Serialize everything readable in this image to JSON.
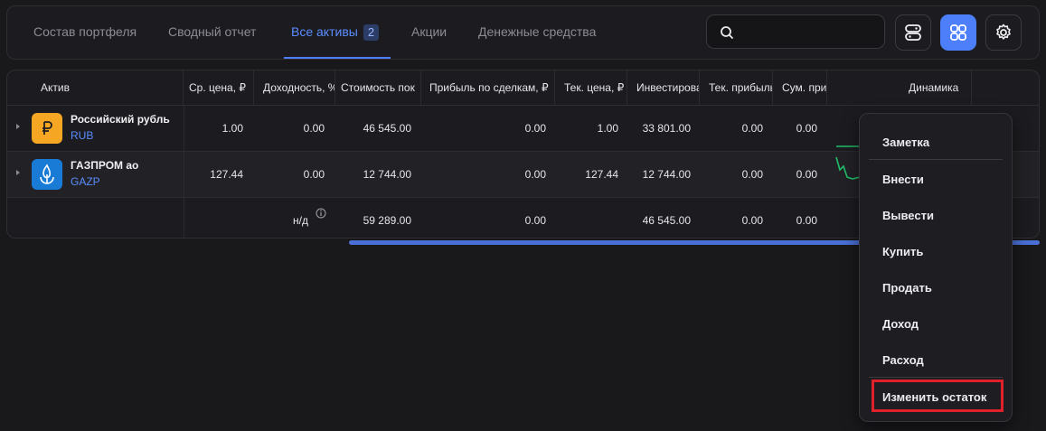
{
  "tabs": [
    {
      "label": "Состав портфеля"
    },
    {
      "label": "Сводный отчет"
    },
    {
      "label": "Все активы",
      "badge": "2"
    },
    {
      "label": "Акции"
    },
    {
      "label": "Денежные средства"
    }
  ],
  "search": {
    "placeholder": ""
  },
  "table": {
    "headers": [
      "Актив",
      "Ср. цена, ₽",
      "Доходность, %",
      "Стоимость пок",
      "Прибыль по сделкам, ₽",
      "Тек. цена, ₽",
      "Инвестирова",
      "Тек. прибыль",
      "Сум. при",
      "Динамика"
    ],
    "rows": [
      {
        "name": "Российский рубль",
        "ticker": "RUB",
        "icon": "ruble-icon",
        "avg_price": "1.00",
        "yield": "0.00",
        "cost": "46 545.00",
        "deal_profit": "0.00",
        "cur_price": "1.00",
        "invested": "33 801.00",
        "cur_profit": "0.00",
        "sum_profit": "0.00"
      },
      {
        "name": "ГАЗПРОМ ао",
        "ticker": "GAZP",
        "icon": "gazprom-logo-icon",
        "avg_price": "127.44",
        "yield": "0.00",
        "cost": "12 744.00",
        "deal_profit": "0.00",
        "cur_price": "127.44",
        "invested": "12 744.00",
        "cur_profit": "0.00",
        "sum_profit": "0.00"
      }
    ],
    "total": {
      "yield": "н/д",
      "cost": "59 289.00",
      "deal_profit": "0.00",
      "invested": "46 545.00",
      "cur_profit": "0.00",
      "sum_profit": "0.00"
    }
  },
  "menu": {
    "items": [
      "Заметка",
      "Внести",
      "Вывести",
      "Купить",
      "Продать",
      "Доход",
      "Расход",
      "Изменить остаток"
    ]
  },
  "colors": {
    "accent": "#4d7ffb",
    "positive": "#1fbf6a",
    "highlight": "#e0202a",
    "ruble": "#f5a623",
    "gazprom": "#1a7bd6"
  }
}
